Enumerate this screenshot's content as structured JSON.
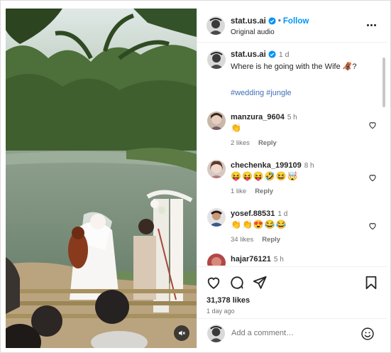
{
  "post": {
    "username": "stat.us.ai",
    "follow_label": "Follow",
    "audio": "Original audio",
    "dot": "•"
  },
  "caption": {
    "username": "stat.us.ai",
    "time": "1 d",
    "text": "Where is he going with the Wife 🦧?",
    "tags": "#wedding #jungle"
  },
  "comments": [
    {
      "username": "manzura_9604",
      "time": "5 h",
      "text": "👏",
      "likes": "2 likes",
      "reply": "Reply"
    },
    {
      "username": "chechenka_199109",
      "time": "8 h",
      "text": "😝😝😝🤣😆🤯",
      "likes": "1 like",
      "reply": "Reply"
    },
    {
      "username": "yosef.88531",
      "time": "1 d",
      "text": "👏👏😍😂😂",
      "likes": "34 likes",
      "reply": "Reply"
    },
    {
      "username": "hajar76121",
      "time": "5 h",
      "text": "",
      "likes": "",
      "reply": ""
    }
  ],
  "footer": {
    "likes": "31,378 likes",
    "ago": "1 day ago",
    "comment_placeholder": "Add a comment…"
  },
  "colors": {
    "accent": "#0095f6",
    "text": "#262626",
    "muted": "#737373",
    "hashtag": "#3f6fb6"
  }
}
